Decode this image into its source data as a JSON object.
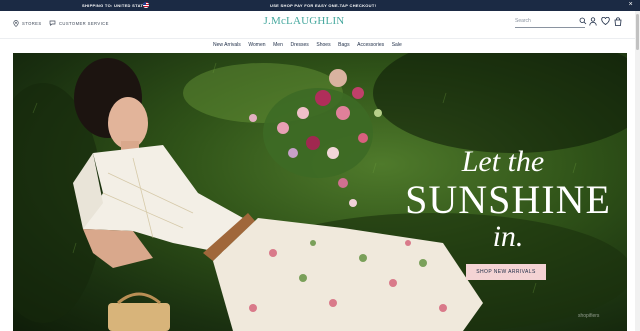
{
  "promo": {
    "shipping": "SHIPPING TO: UNITED STATES",
    "shoppay": "USE SHOP PAY FOR EASY ONE-TAP CHECKOUT!",
    "close": "×"
  },
  "header": {
    "stores": "STORES",
    "customer_service": "CUSTOMER SERVICE",
    "logo": "J.McLAUGHLIN",
    "search_placeholder": "Search"
  },
  "nav": {
    "items": [
      "New Arrivals",
      "Women",
      "Men",
      "Dresses",
      "Shoes",
      "Bags",
      "Accessories",
      "Sale"
    ]
  },
  "hero": {
    "line1": "Let the",
    "line2": "SUNSHINE",
    "line3": "in.",
    "cta": "SHOP NEW ARRIVALS"
  },
  "watermark": "shopifiers",
  "colors": {
    "navy": "#1b2a44",
    "logo_teal": "#46a89e",
    "cta_pink": "#f4d3d4"
  }
}
